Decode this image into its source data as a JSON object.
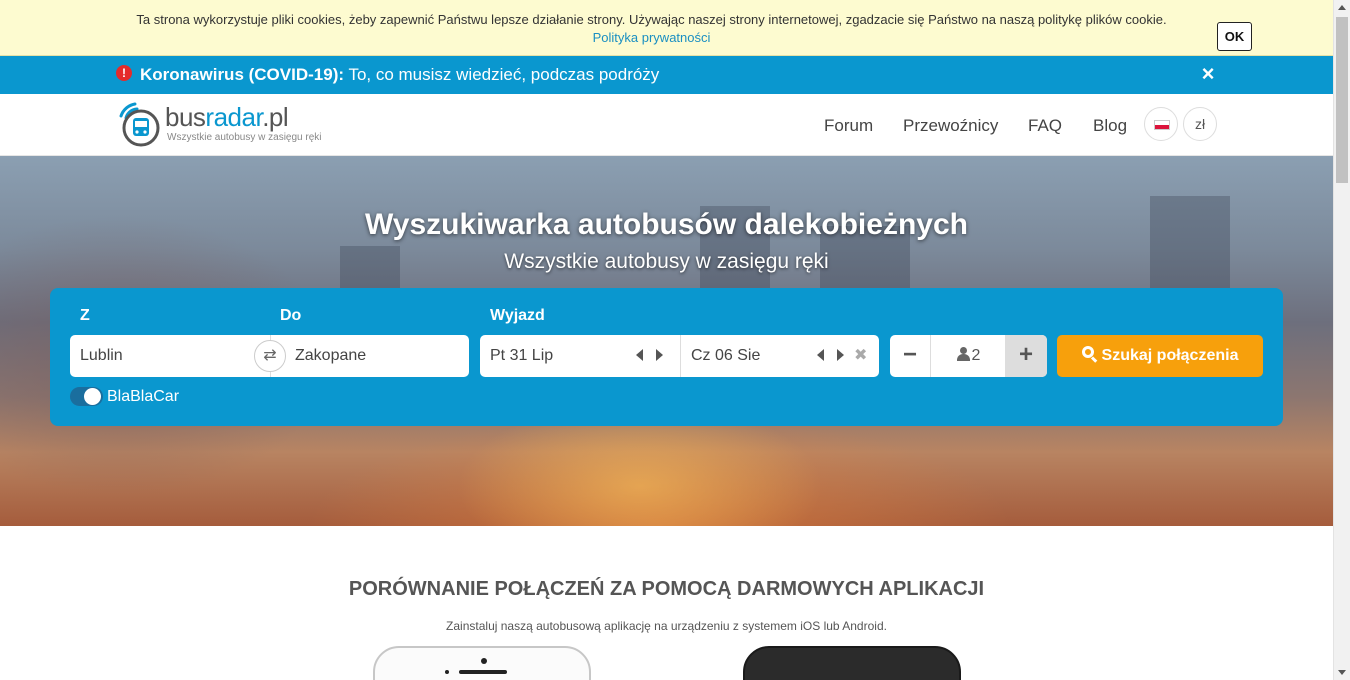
{
  "cookie_bar": {
    "text": "Ta strona wykorzystuje pliki cookies, żeby zapewnić Państwu lepsze działanie strony. Używając naszej strony internetowej, zgadzacie się Państwo na naszą politykę plików cookie.",
    "policy_link": "Polityka prywatności",
    "ok_label": "OK"
  },
  "covid_bar": {
    "title": "Koronawirus (COVID-19):",
    "text": " To, co musisz wiedzieć, podczas podróży",
    "alert_icon": "!",
    "close_icon": "×"
  },
  "header": {
    "logo": {
      "brand_start": "bus",
      "brand_accent": "radar",
      "brand_end": ".pl",
      "tagline": "Wszystkie autobusy w zasięgu ręki"
    },
    "nav": [
      "Forum",
      "Przewoźnicy",
      "FAQ",
      "Blog"
    ],
    "currency": "zł"
  },
  "hero": {
    "title": "Wyszukiwarka autobusów dalekobieżnych",
    "subtitle": "Wszystkie autobusy w zasięgu ręki"
  },
  "search": {
    "from_label": "Z",
    "to_label": "Do",
    "depart_label": "Wyjazd",
    "from_value": "Lublin",
    "to_value": "Zakopane",
    "date_out": "Pt 31 Lip",
    "date_return": "Cz 06 Sie",
    "passengers": "2",
    "minus": "−",
    "plus": "+",
    "clear": "✖",
    "swap": "⇄",
    "button_label": "Szukaj połączenia",
    "blablacar_label": "BlaBlaCar",
    "blablacar_enabled": true
  },
  "apps": {
    "title": "PORÓWNANIE POŁĄCZEŃ ZA POMOCĄ DARMOWYCH APLIKACJI",
    "subtitle": "Zainstaluj naszą autobusową aplikację na urządzeniu z systemem iOS lub Android."
  },
  "colors": {
    "primary": "#0a97cf",
    "cta": "#f7a00c",
    "cookie_bg": "#fdfbd0",
    "alert": "#e52b2b"
  }
}
